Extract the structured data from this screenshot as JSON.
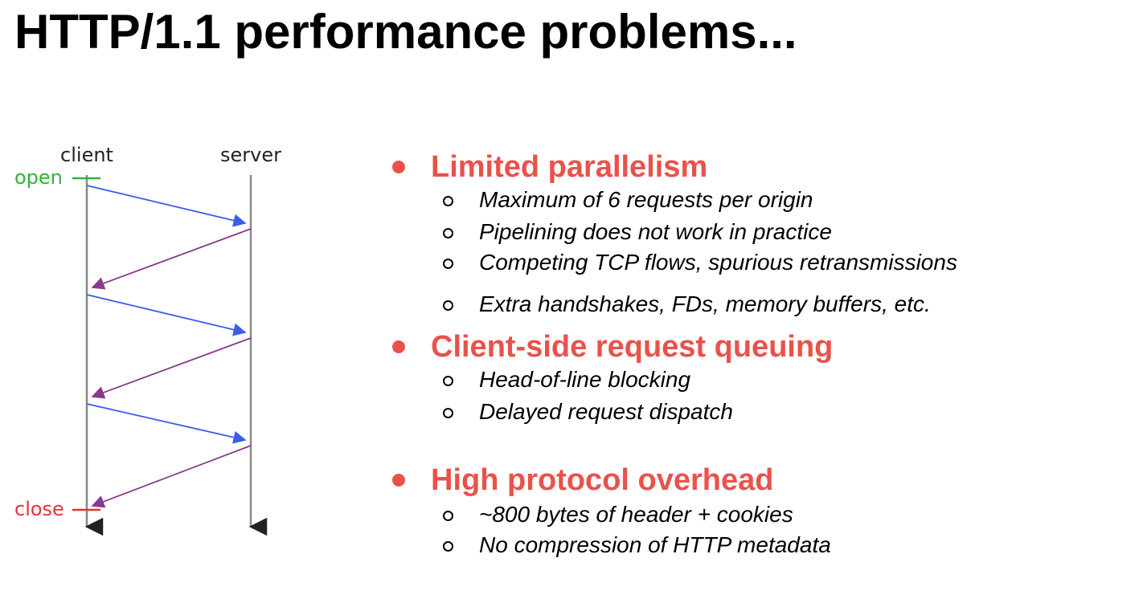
{
  "slide": {
    "title": "HTTP/1.1 performance problems..."
  },
  "diagram": {
    "client_label": "client",
    "server_label": "server",
    "open_label": "open",
    "close_label": "close",
    "colors": {
      "open": "#35b035",
      "close": "#e8303a",
      "request_arrow": "#3a5ee8",
      "response_arrow": "#8a3a8c",
      "timeline": "#888888",
      "label": "#222222"
    }
  },
  "bullets": {
    "accent_color": "#e9524a",
    "groups": [
      {
        "heading": "Limited parallelism",
        "items": [
          "Maximum of 6 requests per origin",
          "Pipelining does not work in practice",
          "Competing TCP flows, spurious retransmissions",
          "Extra handshakes, FDs, memory buffers, etc."
        ]
      },
      {
        "heading": "Client-side request queuing",
        "items": [
          "Head-of-line blocking",
          "Delayed request dispatch"
        ]
      },
      {
        "heading": "High protocol overhead",
        "items": [
          "~800 bytes of header + cookies",
          "No compression of HTTP metadata"
        ]
      }
    ]
  }
}
